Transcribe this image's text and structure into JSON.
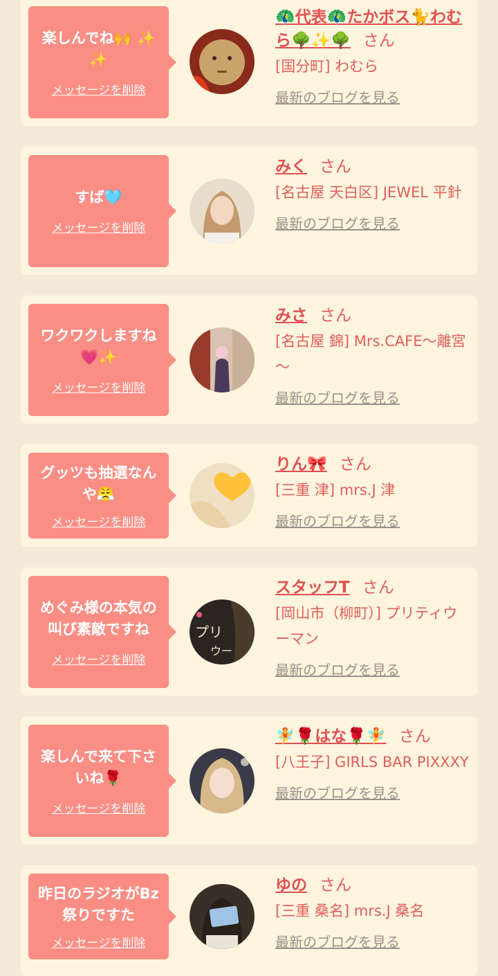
{
  "colors": {
    "page_bg": "#f5ead7",
    "card_bg": "#fff5df",
    "bubble_bg": "#fa8e84",
    "name": "#e14f52",
    "link_gray": "#9a918a"
  },
  "common": {
    "delete_label": "メッセージを削除",
    "san_label": "さん",
    "blog_label": "最新のブログを見る"
  },
  "items": [
    {
      "message": "楽しんでね🙌 ✨✨",
      "name": "🦚代表🦚たかボス🐈わむら🌳✨🌳",
      "shop": "[国分町] わむら",
      "avatar": "doll-face-avatar"
    },
    {
      "message": "すば🩵",
      "name": "みく",
      "shop": "[名古屋 天白区] JEWEL 平針",
      "avatar": "girl-portrait-avatar"
    },
    {
      "message": "ワクワクしますね💗✨",
      "name": "みさ",
      "shop": "[名古屋 錦] Mrs.CAFE～離宮～",
      "avatar": "kimono-woman-avatar"
    },
    {
      "message": "グッツも抽選なんや😤",
      "name": "りん🎀",
      "shop": "[三重 津] mrs.J 津",
      "avatar": "heart-covered-avatar"
    },
    {
      "message": "めぐみ様の本気の叫び素敵ですね",
      "name": "スタッフT",
      "shop": "[岡山市（柳町）] プリティウーマン",
      "avatar": "pretty-woman-logo-avatar"
    },
    {
      "message": "楽しんで来て下さいね🌹",
      "name": "🧚🌹はな🌹🧚",
      "shop": "[八王子] GIRLS BAR PIXXXY",
      "avatar": "blonde-girl-avatar"
    },
    {
      "message": "昨日のラジオがBz祭りですた",
      "name": "ゆの",
      "shop": "[三重 桑名] mrs.J 桑名",
      "avatar": "card-face-avatar"
    }
  ]
}
